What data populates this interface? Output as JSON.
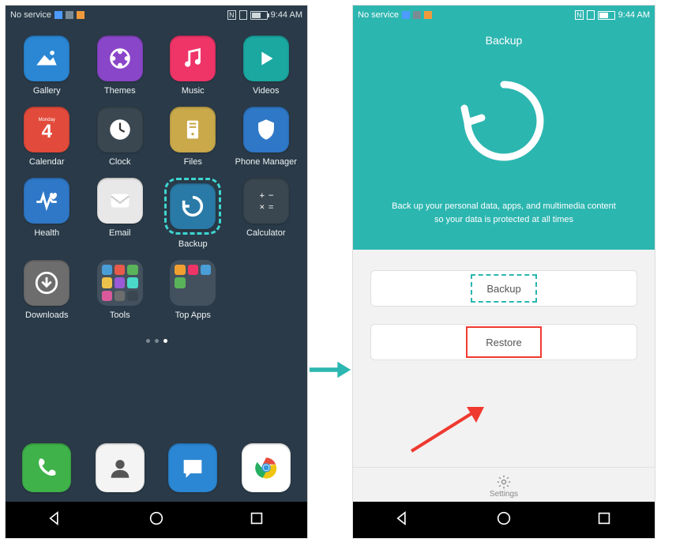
{
  "status": {
    "carrier": "No service",
    "time": "9:44 AM"
  },
  "home": {
    "apps": [
      {
        "label": "Gallery"
      },
      {
        "label": "Themes"
      },
      {
        "label": "Music"
      },
      {
        "label": "Videos"
      },
      {
        "label": "Calendar",
        "badge_day": "4",
        "badge_weekday": "Monday"
      },
      {
        "label": "Clock"
      },
      {
        "label": "Files"
      },
      {
        "label": "Phone Manager"
      },
      {
        "label": "Health"
      },
      {
        "label": "Email"
      },
      {
        "label": "Backup"
      },
      {
        "label": "Calculator"
      },
      {
        "label": "Downloads"
      },
      {
        "label": "Tools"
      },
      {
        "label": "Top Apps"
      }
    ],
    "dock": [
      "Phone",
      "Contacts",
      "Messages",
      "Browser"
    ]
  },
  "backup_screen": {
    "title": "Backup",
    "description_line1": "Back up your personal data, apps, and multimedia content",
    "description_line2": "so your data is protected at all times",
    "backup_btn": "Backup",
    "restore_btn": "Restore",
    "settings_label": "Settings"
  }
}
